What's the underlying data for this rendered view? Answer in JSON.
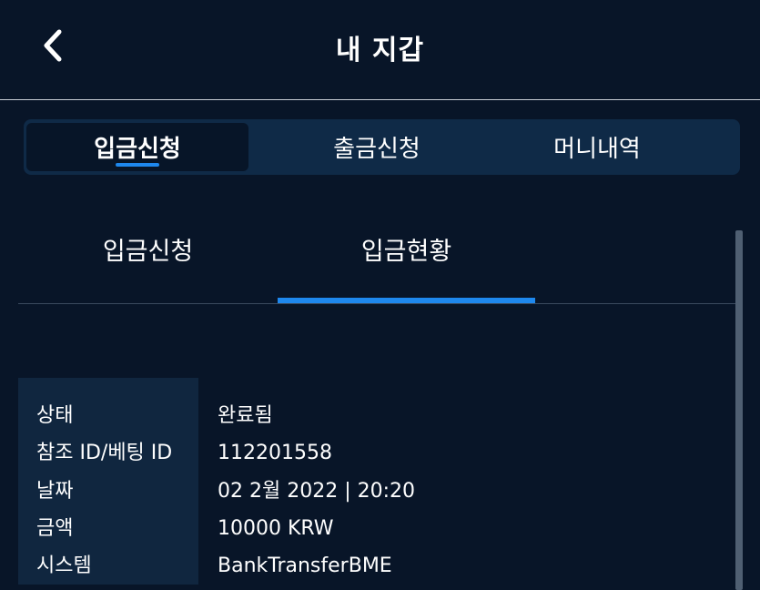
{
  "header": {
    "title": "내 지갑",
    "back_icon": "chevron-left-icon"
  },
  "main_tabs": [
    {
      "label": "입금신청",
      "active": true
    },
    {
      "label": "출금신청",
      "active": false
    },
    {
      "label": "머니내역",
      "active": false
    }
  ],
  "sub_tabs": [
    {
      "label": "입금신청",
      "active": false
    },
    {
      "label": "입금현황",
      "active": true
    }
  ],
  "details": {
    "status": {
      "label": "상태",
      "value": "완료됨"
    },
    "reference": {
      "label": "참조 ID/베팅 ID",
      "value": "112201558"
    },
    "date": {
      "label": "날짜",
      "value": "02 2월 2022 | 20:20"
    },
    "amount": {
      "label": "금액",
      "value": "10000 KRW"
    },
    "system": {
      "label": "시스템",
      "value": "BankTransferBME"
    }
  },
  "colors": {
    "background": "#081528",
    "accent": "#1e88ee",
    "tab_bar": "#0f2a47",
    "label_panel": "#10263f"
  }
}
